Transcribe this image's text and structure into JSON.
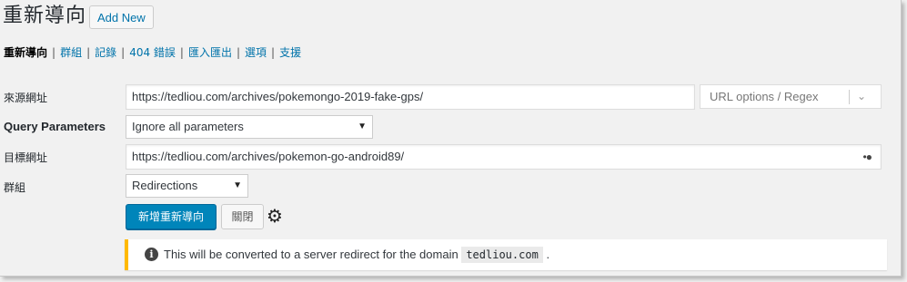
{
  "header": {
    "title": "重新導向",
    "add_new_label": "Add New"
  },
  "subnav": [
    {
      "label": "重新導向",
      "current": true
    },
    {
      "label": "群組"
    },
    {
      "label": "記錄"
    },
    {
      "label": "404 錯誤"
    },
    {
      "label": "匯入匯出"
    },
    {
      "label": "選項"
    },
    {
      "label": "支援"
    }
  ],
  "form": {
    "source": {
      "label": "來源網址",
      "value": "https://tedliou.com/archives/pokemongo-2019-fake-gps/"
    },
    "url_options": {
      "placeholder": "URL options / Regex",
      "chevron_icon": "chevron-down-icon"
    },
    "query": {
      "label": "Query Parameters",
      "value": "Ignore all parameters"
    },
    "target": {
      "label": "目標網址",
      "value": "https://tedliou.com/archives/pokemon-go-android89/",
      "icon": "dots-icon"
    },
    "group": {
      "label": "群組",
      "value": "Redirections"
    },
    "submit_label": "新增重新導向",
    "close_label": "關閉",
    "settings_icon": "gear-icon"
  },
  "notice": {
    "text": "This will be converted to a server redirect for the domain",
    "domain": "tedliou.com",
    "suffix": ".",
    "accent": "#ffb900"
  },
  "colors": {
    "primary": "#0085ba",
    "link": "#0073aa"
  }
}
